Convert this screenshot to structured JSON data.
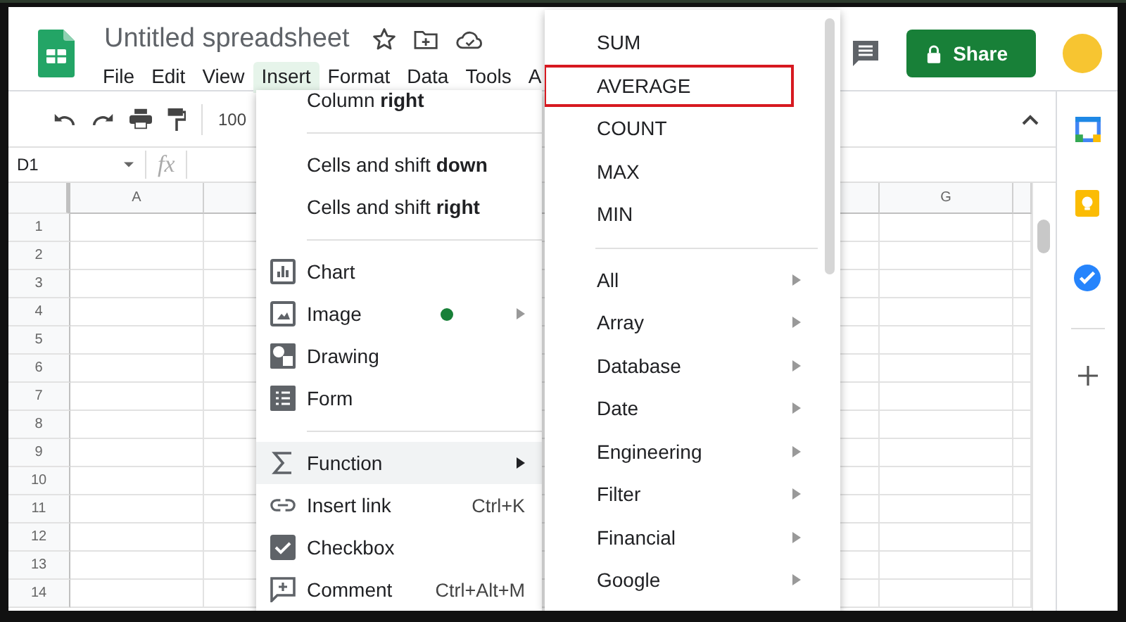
{
  "document": {
    "title": "Untitled spreadsheet"
  },
  "menu_bar": [
    {
      "label": "File",
      "selected": false
    },
    {
      "label": "Edit",
      "selected": false
    },
    {
      "label": "View",
      "selected": false
    },
    {
      "label": "Insert",
      "selected": true
    },
    {
      "label": "Format",
      "selected": false
    },
    {
      "label": "Data",
      "selected": false
    },
    {
      "label": "Tools",
      "selected": false
    },
    {
      "label": "A",
      "selected": false
    }
  ],
  "share_button": {
    "label": "Share"
  },
  "toolbar": {
    "zoom": "100"
  },
  "formula_bar": {
    "cell_ref": "D1",
    "fx": "fx"
  },
  "grid": {
    "columns_visible": [
      "A",
      "G"
    ],
    "rows": [
      "1",
      "2",
      "3",
      "4",
      "5",
      "6",
      "7",
      "8",
      "9",
      "10",
      "11",
      "12",
      "13",
      "14"
    ]
  },
  "insert_menu": {
    "items": [
      {
        "kind": "item",
        "label": "Column **right**",
        "selected": false
      },
      {
        "kind": "separator"
      },
      {
        "kind": "item",
        "label": "Cells and shift **down**",
        "selected": false
      },
      {
        "kind": "item",
        "label": "Cells and shift **right**",
        "selected": false
      },
      {
        "kind": "separator"
      },
      {
        "kind": "item",
        "label": "Chart",
        "selected": false
      },
      {
        "kind": "item",
        "label": "Image",
        "submenu": true,
        "new_dot": true,
        "selected": false
      },
      {
        "kind": "item",
        "label": "Drawing",
        "selected": false
      },
      {
        "kind": "item",
        "label": "Form",
        "selected": false
      },
      {
        "kind": "separator"
      },
      {
        "kind": "item",
        "label": "Function",
        "submenu": true,
        "selected": true
      },
      {
        "kind": "item",
        "label": "Insert link",
        "shortcut": "Ctrl+K",
        "selected": false
      },
      {
        "kind": "item",
        "label": "Checkbox",
        "selected": false
      },
      {
        "kind": "item",
        "label": "Comment",
        "shortcut": "Ctrl+Alt+M",
        "selected": false
      }
    ]
  },
  "function_menu": {
    "items": [
      {
        "kind": "item",
        "label": "SUM",
        "highlighted": false
      },
      {
        "kind": "item",
        "label": "AVERAGE",
        "highlighted": true
      },
      {
        "kind": "item",
        "label": "COUNT",
        "highlighted": false
      },
      {
        "kind": "item",
        "label": "MAX",
        "highlighted": false
      },
      {
        "kind": "item",
        "label": "MIN",
        "highlighted": false
      },
      {
        "kind": "separator"
      },
      {
        "kind": "item",
        "label": "All",
        "submenu": true,
        "highlighted": false
      },
      {
        "kind": "item",
        "label": "Array",
        "submenu": true,
        "highlighted": false
      },
      {
        "kind": "item",
        "label": "Database",
        "submenu": true,
        "highlighted": false
      },
      {
        "kind": "item",
        "label": "Date",
        "submenu": true,
        "highlighted": false
      },
      {
        "kind": "item",
        "label": "Engineering",
        "submenu": true,
        "highlighted": false
      },
      {
        "kind": "item",
        "label": "Filter",
        "submenu": true,
        "highlighted": false
      },
      {
        "kind": "item",
        "label": "Financial",
        "submenu": true,
        "highlighted": false
      },
      {
        "kind": "item",
        "label": "Google",
        "submenu": true,
        "highlighted": false
      }
    ]
  }
}
